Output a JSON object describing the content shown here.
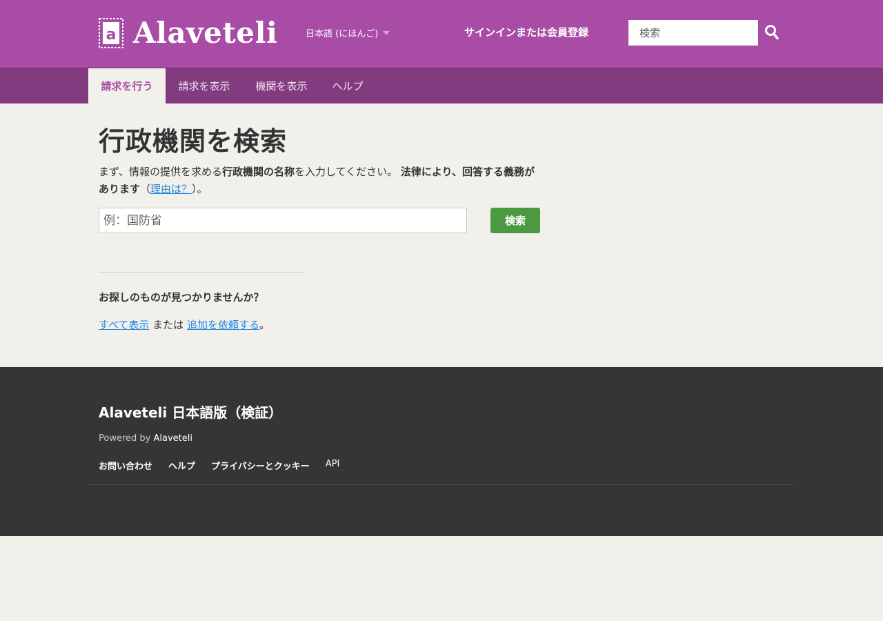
{
  "header": {
    "logo_text": "Alaveteli",
    "language": "日本語 (にほんご)",
    "signin": "サインインまたは会員登録",
    "search_placeholder": "検索"
  },
  "nav": {
    "items": [
      {
        "label": "請求を行う",
        "active": true
      },
      {
        "label": "請求を表示",
        "active": false
      },
      {
        "label": "機関を表示",
        "active": false
      },
      {
        "label": "ヘルプ",
        "active": false
      }
    ]
  },
  "main": {
    "title": "行政機関を検索",
    "intro_1": "まず、情報の提供を求める",
    "intro_bold_1": "行政機関の名称",
    "intro_2": "を入力してください。 ",
    "intro_bold_2": "法律により、回答する義務があります",
    "intro_3": "（",
    "intro_link": "理由は？",
    "intro_4": "）。",
    "search_placeholder": "例：国防省",
    "search_button": "検索",
    "notfound_heading": "お探しのものが見つかりませんか？",
    "notfound_link_1": "すべて表示",
    "notfound_mid": "または",
    "notfound_link_2": "追加を依頼する",
    "notfound_end": "。"
  },
  "footer": {
    "title": "Alaveteli 日本語版（検証）",
    "powered_prefix": "Powered by",
    "powered_link": "Alaveteli",
    "links": [
      "お問い合わせ",
      "ヘルプ",
      "プライバシーとクッキー",
      "API"
    ]
  },
  "colors": {
    "brand": "#a94ca6",
    "nav": "#833b80",
    "button": "#4b9a42",
    "link": "#2688dc",
    "footer": "#353535"
  }
}
